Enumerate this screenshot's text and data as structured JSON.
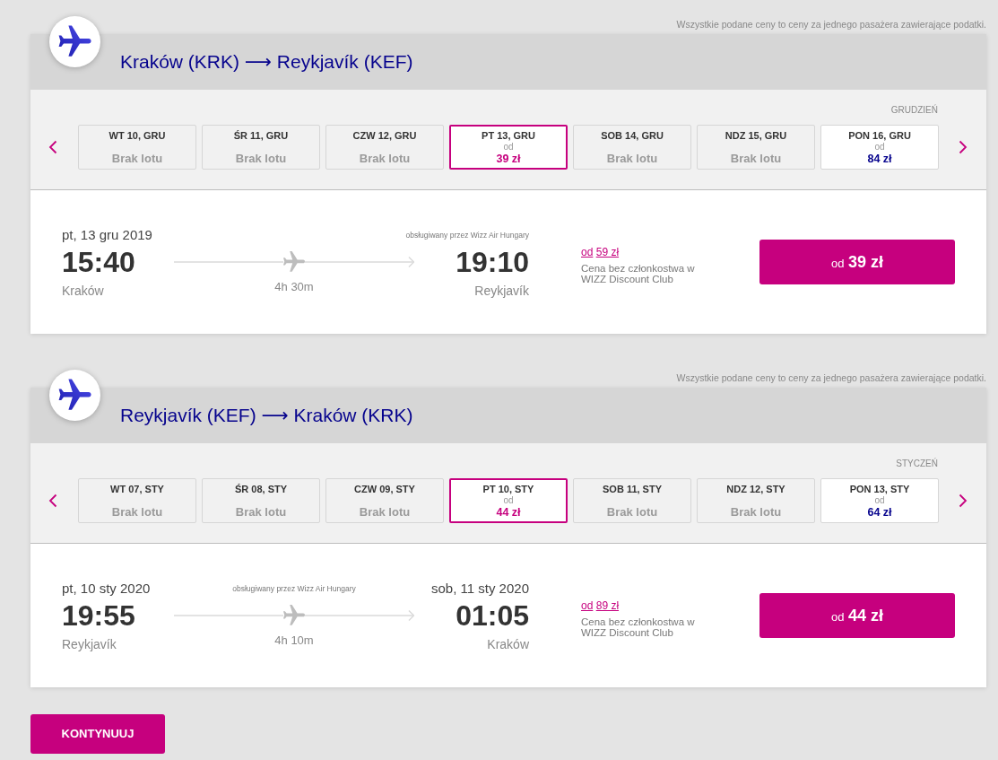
{
  "flights": [
    {
      "price_note": "Wszystkie podane ceny to ceny za jednego pasażera zawierające podatki.",
      "title": "Kraków (KRK) ⟶ Reykjavík (KEF)",
      "month": "GRUDZIEŃ",
      "days": [
        {
          "label": "WT 10, GRU",
          "available": false,
          "selected": false,
          "status": "Brak lotu"
        },
        {
          "label": "ŚR 11, GRU",
          "available": false,
          "selected": false,
          "status": "Brak lotu"
        },
        {
          "label": "CZW 12, GRU",
          "available": false,
          "selected": false,
          "status": "Brak lotu"
        },
        {
          "label": "PT 13, GRU",
          "available": true,
          "selected": true,
          "from": "od",
          "price": "39 zł"
        },
        {
          "label": "SOB 14, GRU",
          "available": false,
          "selected": false,
          "status": "Brak lotu"
        },
        {
          "label": "NDZ 15, GRU",
          "available": false,
          "selected": false,
          "status": "Brak lotu"
        },
        {
          "label": "PON 16, GRU",
          "available": true,
          "selected": false,
          "from": "od",
          "price": "84 zł"
        }
      ],
      "departure": {
        "date": "pt, 13 gru 2019",
        "time": "15:40",
        "city": "Kraków"
      },
      "operator": "obsługiwany przez Wizz Air Hungary",
      "duration": "4h 30m",
      "arrival": {
        "time": "19:10",
        "city": "Reykjavík"
      },
      "member_price": {
        "from": "od",
        "price": "59 zł",
        "note": "Cena bez członkostwa w WIZZ Discount Club"
      },
      "fare_button": {
        "from": "od",
        "price": "39 zł"
      }
    },
    {
      "price_note": "Wszystkie podane ceny to ceny za jednego pasażera zawierające podatki.",
      "title": "Reykjavík (KEF) ⟶ Kraków (KRK)",
      "month": "STYCZEŃ",
      "days": [
        {
          "label": "WT 07, STY",
          "available": false,
          "selected": false,
          "status": "Brak lotu"
        },
        {
          "label": "ŚR 08, STY",
          "available": false,
          "selected": false,
          "status": "Brak lotu"
        },
        {
          "label": "CZW 09, STY",
          "available": false,
          "selected": false,
          "status": "Brak lotu"
        },
        {
          "label": "PT 10, STY",
          "available": true,
          "selected": true,
          "from": "od",
          "price": "44 zł"
        },
        {
          "label": "SOB 11, STY",
          "available": false,
          "selected": false,
          "status": "Brak lotu"
        },
        {
          "label": "NDZ 12, STY",
          "available": false,
          "selected": false,
          "status": "Brak lotu"
        },
        {
          "label": "PON 13, STY",
          "available": true,
          "selected": false,
          "from": "od",
          "price": "64 zł"
        }
      ],
      "departure": {
        "date": "pt, 10 sty 2020",
        "time": "19:55",
        "city": "Reykjavík"
      },
      "operator": "obsługiwany przez Wizz Air Hungary",
      "duration": "4h 10m",
      "arrival": {
        "date": "sob, 11 sty 2020",
        "time": "01:05",
        "city": "Kraków"
      },
      "member_price": {
        "from": "od",
        "price": "89 zł",
        "note": "Cena bez członkostwa w WIZZ Discount Club"
      },
      "fare_button": {
        "from": "od",
        "price": "44 zł"
      }
    }
  ],
  "continue_button": "KONTYNUUJ"
}
